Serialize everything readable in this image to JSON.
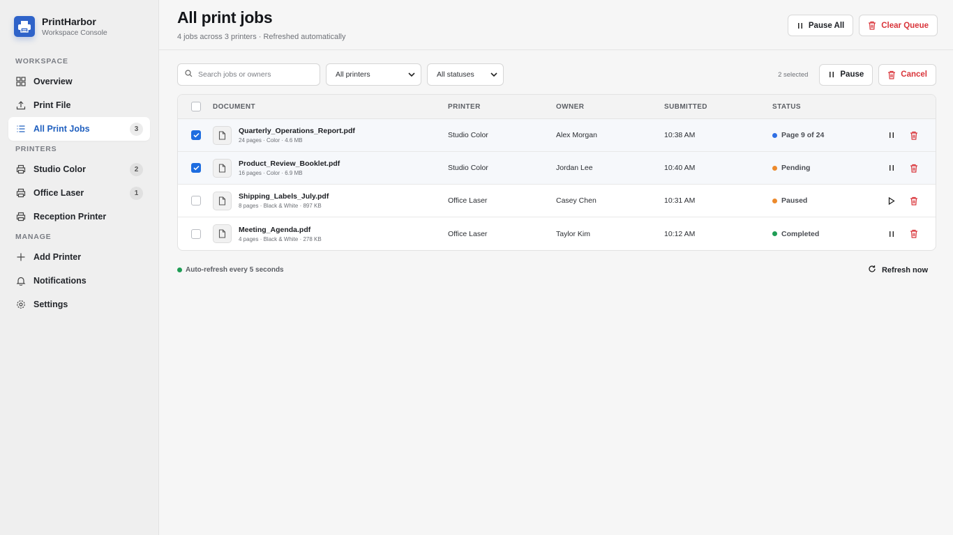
{
  "brand": {
    "name": "PrintHarbor",
    "subtitle": "Workspace Console"
  },
  "sidebar": {
    "sections": [
      {
        "label": "WORKSPACE",
        "items": [
          {
            "label": "Overview",
            "icon": "grid-icon"
          },
          {
            "label": "Print File",
            "icon": "upload-icon"
          },
          {
            "label": "All Print Jobs",
            "icon": "list-icon",
            "badge": "3",
            "active": true
          }
        ]
      },
      {
        "label": "PRINTERS",
        "items": [
          {
            "label": "Studio Color",
            "icon": "printer-icon",
            "badge": "2"
          },
          {
            "label": "Office Laser",
            "icon": "printer-icon",
            "badge": "1"
          },
          {
            "label": "Reception Printer",
            "icon": "printer-icon"
          }
        ]
      },
      {
        "label": "MANAGE",
        "items": [
          {
            "label": "Add Printer",
            "icon": "plus-icon"
          },
          {
            "label": "Notifications",
            "icon": "bell-icon"
          },
          {
            "label": "Settings",
            "icon": "gear-icon"
          }
        ]
      }
    ]
  },
  "header": {
    "title": "All print jobs",
    "subtitle": "4 jobs across 3 printers · Refreshed automatically",
    "pause_all": "Pause All",
    "clear_queue": "Clear Queue"
  },
  "toolbar": {
    "search_placeholder": "Search jobs or owners",
    "printer_filter": "All printers",
    "status_filter": "All statuses",
    "selected_count": "2 selected",
    "pause": "Pause",
    "cancel": "Cancel"
  },
  "table": {
    "columns": [
      "DOCUMENT",
      "PRINTER",
      "OWNER",
      "SUBMITTED",
      "STATUS"
    ],
    "rows": [
      {
        "selected": true,
        "name": "Quarterly_Operations_Report.pdf",
        "meta": "24 pages · Color · 4.6 MB",
        "printer": "Studio Color",
        "owner": "Alex Morgan",
        "submitted": "10:38 AM",
        "status": "Page 9 of 24",
        "status_color": "#2f6fe4",
        "action": "pause"
      },
      {
        "selected": true,
        "name": "Product_Review_Booklet.pdf",
        "meta": "16 pages · Color · 6.9 MB",
        "printer": "Studio Color",
        "owner": "Jordan Lee",
        "submitted": "10:40 AM",
        "status": "Pending",
        "status_color": "#ec8a2c",
        "action": "pause"
      },
      {
        "selected": false,
        "name": "Shipping_Labels_July.pdf",
        "meta": "8 pages · Black & White · 897 KB",
        "printer": "Office Laser",
        "owner": "Casey Chen",
        "submitted": "10:31 AM",
        "status": "Paused",
        "status_color": "#ec8a2c",
        "action": "play"
      },
      {
        "selected": false,
        "name": "Meeting_Agenda.pdf",
        "meta": "4 pages · Black & White · 278 KB",
        "printer": "Office Laser",
        "owner": "Taylor Kim",
        "submitted": "10:12 AM",
        "status": "Completed",
        "status_color": "#1f9d55",
        "action": "pause"
      }
    ]
  },
  "footer": {
    "auto_refresh": "Auto-refresh every 5 seconds",
    "auto_refresh_color": "#1f9d55",
    "refresh_now": "Refresh now"
  },
  "colors": {
    "accent": "#1e6de0",
    "danger": "#d9343a",
    "active_nav": "#1f5fbf"
  }
}
